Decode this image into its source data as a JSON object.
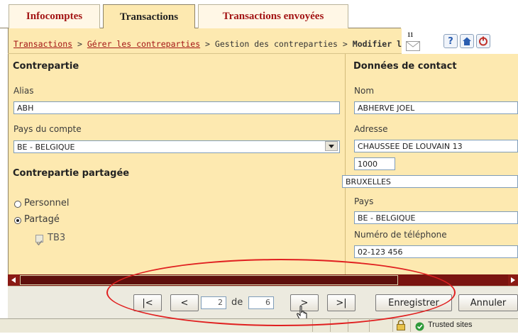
{
  "tabs": [
    {
      "label": "Infocomptes"
    },
    {
      "label": "Transactions"
    },
    {
      "label": "Transactions envoyées"
    }
  ],
  "breadcrumb": {
    "link1": "Transactions",
    "sep1": " > ",
    "link2": "Gérer les contreparties",
    "sep2": " > Gestion des contreparties > ",
    "current": "Modifier la"
  },
  "toolbar": {
    "message_count": "11",
    "help": "?"
  },
  "left": {
    "section_title": "Contrepartie",
    "alias_label": "Alias",
    "alias_value": "ABH",
    "country_label": "Pays du compte",
    "country_value": "BE - BELGIQUE",
    "shared_title": "Contrepartie partagée",
    "radio_personal": "Personnel",
    "radio_shared": "Partagé",
    "checkbox_label": "TB3"
  },
  "right": {
    "section_title": "Données de contact",
    "name_label": "Nom",
    "name_value": "ABHERVE JOEL",
    "address_label": "Adresse",
    "street_value": "CHAUSSEE DE LOUVAIN 13",
    "postcode_value": "1000",
    "city_value": "BRUXELLES",
    "country_label": "Pays",
    "country_value": "BE - BELGIQUE",
    "phone_label": "Numéro de téléphone",
    "phone_value": "02-123 456"
  },
  "pager": {
    "first": "|<",
    "prev": "<",
    "current_page": "2",
    "of": "de",
    "total_pages": "6",
    "next": ">",
    "last": ">|"
  },
  "actions": {
    "save": "Enregistrer",
    "cancel": "Annuler"
  },
  "statusbar": {
    "zone": "Trusted sites"
  },
  "colors": {
    "panel_bg": "#fde9b0",
    "tab_active_bg": "#fde9b0",
    "tab_text": "#a31515",
    "scrollbar_dark": "#7a1410",
    "annotation_ellipse": "#e02020"
  }
}
